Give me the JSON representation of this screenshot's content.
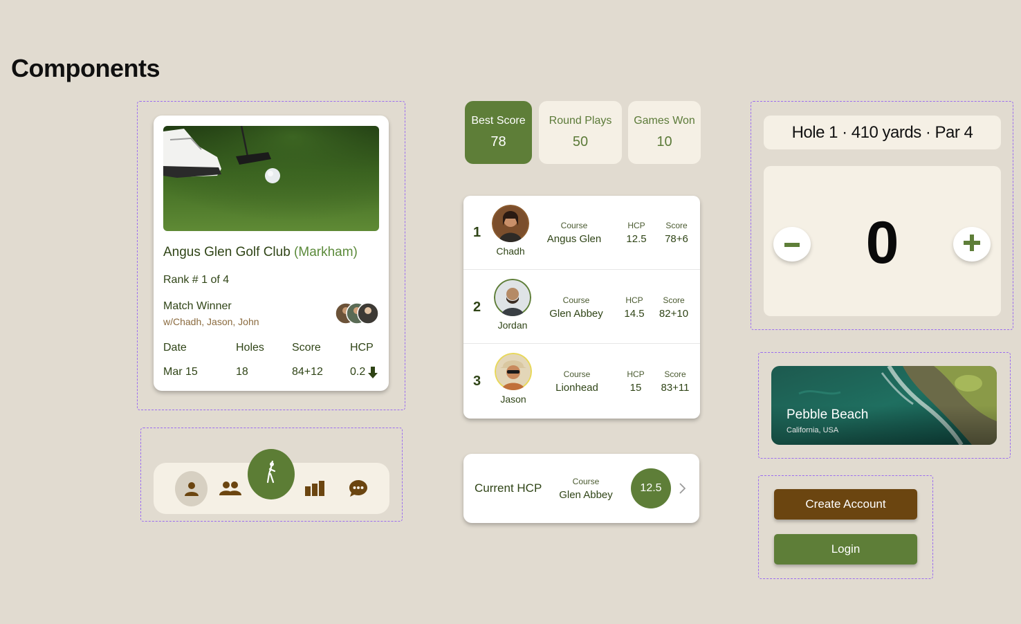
{
  "page": {
    "title": "Components"
  },
  "course_card": {
    "name": "Angus Glen Golf Club",
    "location": "(Markham)",
    "rank": "Rank # 1 of 4",
    "match_title": "Match Winner",
    "match_players": "w/Chadh, Jason, John",
    "stats": {
      "headers": [
        "Date",
        "Holes",
        "Score",
        "HCP"
      ],
      "values": [
        "Mar 15",
        "18",
        "84+12",
        "0.2"
      ],
      "hcp_trend": "down-arrow-icon"
    }
  },
  "nav": {
    "items": [
      {
        "icon": "person-icon",
        "active": true
      },
      {
        "icon": "group-icon",
        "active": false
      },
      {
        "icon": "golfer-icon",
        "center": true
      },
      {
        "icon": "bar-chart-icon",
        "active": false
      },
      {
        "icon": "chat-bubble-icon",
        "active": false
      }
    ]
  },
  "stat_tiles": [
    {
      "label": "Best Score",
      "value": "78",
      "active": true
    },
    {
      "label": "Round Plays",
      "value": "50",
      "active": false
    },
    {
      "label": "Games Won",
      "value": "10",
      "active": false
    }
  ],
  "leaderboard": {
    "rows": [
      {
        "rank": "1",
        "name": "Chadh",
        "course_label": "Course",
        "course": "Angus Glen",
        "hcp_label": "HCP",
        "hcp": "12.5",
        "score_label": "Score",
        "score": "78+6"
      },
      {
        "rank": "2",
        "name": "Jordan",
        "course_label": "Course",
        "course": "Glen Abbey",
        "hcp_label": "HCP",
        "hcp": "14.5",
        "score_label": "Score",
        "score": "82+10"
      },
      {
        "rank": "3",
        "name": "Jason",
        "course_label": "Course",
        "course": "Lionhead",
        "hcp_label": "HCP",
        "hcp": "15",
        "score_label": "Score",
        "score": "83+11"
      }
    ]
  },
  "current_hcp": {
    "label": "Current HCP",
    "course_label": "Course",
    "course": "Glen Abbey",
    "value": "12.5"
  },
  "hole": {
    "title": "Hole 1 · 410 yards · Par 4",
    "count": "0"
  },
  "featured_course": {
    "name": "Pebble Beach",
    "location": "California, USA"
  },
  "buttons": {
    "create_account": "Create Account",
    "login": "Login"
  },
  "colors": {
    "background": "#e1dbd0",
    "primary_green": "#5e7e38",
    "brown": "#6b4510",
    "cream": "#f5f0e5",
    "dashed_outline": "#9b6cf0"
  }
}
